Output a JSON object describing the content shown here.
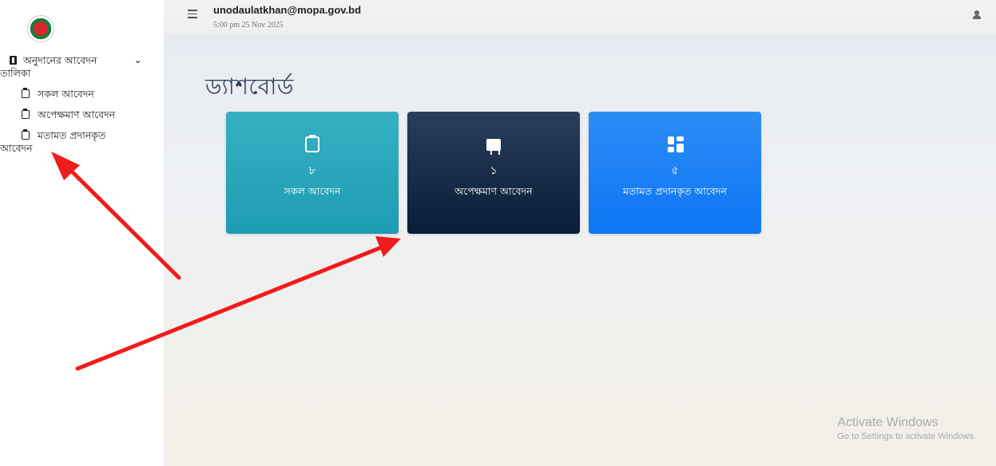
{
  "sidebar": {
    "logo_icon": "bangladesh-government-logo",
    "group": {
      "label_line1": "অনুদানের আবেদন",
      "label_line2": "তালিকা",
      "icon": "id-card-icon",
      "expand_icon": "chevron-down-icon"
    },
    "items": [
      {
        "label": "সকল আবেদন",
        "icon": "clipboard-icon"
      },
      {
        "label": "অপেক্ষমাণ আবেদন",
        "icon": "clipboard-icon"
      },
      {
        "label_line1": "মতামত প্রদানকৃত",
        "label_line2": "আবেদন",
        "icon": "clipboard-icon"
      }
    ]
  },
  "header": {
    "menu_icon": "hamburger-icon",
    "user_email": "unodaulatkhan@mopa.gov.bd",
    "datetime": "5:00 pm 25 Nov 2025",
    "user_icon": "user-icon"
  },
  "main": {
    "title": "ড্যাশবোর্ড",
    "cards": [
      {
        "icon": "clipboard-icon",
        "count": "৮",
        "label": "সকল আবেদন",
        "color": "#1fa2b8"
      },
      {
        "icon": "presentation-board-icon",
        "count": "১",
        "label": "অপেক্ষমাণ আবেদন",
        "color": "#0b2341"
      },
      {
        "icon": "dashboard-grid-icon",
        "count": "৫",
        "label": "মতামত প্রদানকৃত আবেদন",
        "color": "#1a82f7"
      }
    ]
  },
  "watermark": {
    "line1": "Activate Windows",
    "line2": "Go to Settings to activate Windows."
  },
  "annotation_color": "#f01c1c"
}
